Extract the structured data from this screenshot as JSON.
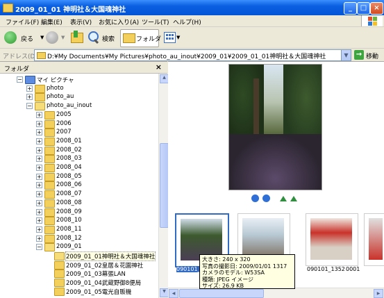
{
  "window": {
    "title": "2009_01_01 神明社＆大国魂神社",
    "minimize": "_",
    "maximize": "□",
    "close": "×"
  },
  "menu": [
    "ファイル(F)",
    "編集(E)",
    "表示(V)",
    "お気に入り(A)",
    "ツール(T)",
    "ヘルプ(H)"
  ],
  "toolbar": {
    "back_label": "戻る",
    "search_label": "検索",
    "folders_label": "フォルダ"
  },
  "address": {
    "label": "アドレス(D)",
    "value": "D:¥My Documents¥My Pictures¥photo_au_inout¥2009_01¥2009_01_01神明社＆大国魂神社",
    "go_label": "移動"
  },
  "folder_pane": {
    "title": "フォルダ",
    "close": "×",
    "nodes": [
      {
        "label": "マイ ピクチャ",
        "expander": "−",
        "indent": 0,
        "kind": "special"
      },
      {
        "label": "photo",
        "expander": "+",
        "indent": 1,
        "kind": "folder"
      },
      {
        "label": "photo_au",
        "expander": "+",
        "indent": 1,
        "kind": "folder"
      },
      {
        "label": "photo_au_inout",
        "expander": "−",
        "indent": 1,
        "kind": "open"
      },
      {
        "label": "2005",
        "expander": "+",
        "indent": 2,
        "kind": "folder"
      },
      {
        "label": "2006",
        "expander": "+",
        "indent": 2,
        "kind": "folder"
      },
      {
        "label": "2007",
        "expander": "+",
        "indent": 2,
        "kind": "folder"
      },
      {
        "label": "2008_01",
        "expander": "+",
        "indent": 2,
        "kind": "folder"
      },
      {
        "label": "2008_02",
        "expander": "+",
        "indent": 2,
        "kind": "folder"
      },
      {
        "label": "2008_03",
        "expander": "+",
        "indent": 2,
        "kind": "folder"
      },
      {
        "label": "2008_04",
        "expander": "+",
        "indent": 2,
        "kind": "folder"
      },
      {
        "label": "2008_05",
        "expander": "+",
        "indent": 2,
        "kind": "folder"
      },
      {
        "label": "2008_06",
        "expander": "+",
        "indent": 2,
        "kind": "folder"
      },
      {
        "label": "2008_07",
        "expander": "+",
        "indent": 2,
        "kind": "folder"
      },
      {
        "label": "2008_08",
        "expander": "+",
        "indent": 2,
        "kind": "folder"
      },
      {
        "label": "2008_09",
        "expander": "+",
        "indent": 2,
        "kind": "folder"
      },
      {
        "label": "2008_10",
        "expander": "+",
        "indent": 2,
        "kind": "folder"
      },
      {
        "label": "2008_11",
        "expander": "+",
        "indent": 2,
        "kind": "folder"
      },
      {
        "label": "2008_12",
        "expander": "+",
        "indent": 2,
        "kind": "folder"
      },
      {
        "label": "2009_01",
        "expander": "−",
        "indent": 2,
        "kind": "open"
      },
      {
        "label": "2009_01_01神明社＆大国魂神社",
        "expander": "",
        "indent": 3,
        "kind": "open",
        "selected": true
      },
      {
        "label": "2009_01_02皇居＆花園神社",
        "expander": "",
        "indent": 3,
        "kind": "folder"
      },
      {
        "label": "2009_01_03幕張LAN",
        "expander": "",
        "indent": 3,
        "kind": "folder"
      },
      {
        "label": "2009_01_04武蔵野御8便局",
        "expander": "",
        "indent": 3,
        "kind": "folder"
      },
      {
        "label": "2009_01_05電光自販機",
        "expander": "",
        "indent": 3,
        "kind": "folder"
      }
    ]
  },
  "viewer": {
    "thumbnails": [
      {
        "label": "090101_1317",
        "selected": true
      },
      {
        "label": "",
        "selected": false
      },
      {
        "label": "090101_1352",
        "selected": false
      },
      {
        "label": "",
        "selected": false
      }
    ],
    "extra_label": "0001"
  },
  "tooltip": {
    "lines": [
      "大きさ: 240 x 320",
      "写真の撮影日: 2009/01/01 1317",
      "カメラのモデル: W53SA",
      "種類: JPEG イメージ",
      "サイズ: 26.9 KB"
    ]
  },
  "colors": {
    "titlebar": "#0a5fe0",
    "selection": "#316ac5",
    "tooltip_bg": "#ffffe1"
  }
}
